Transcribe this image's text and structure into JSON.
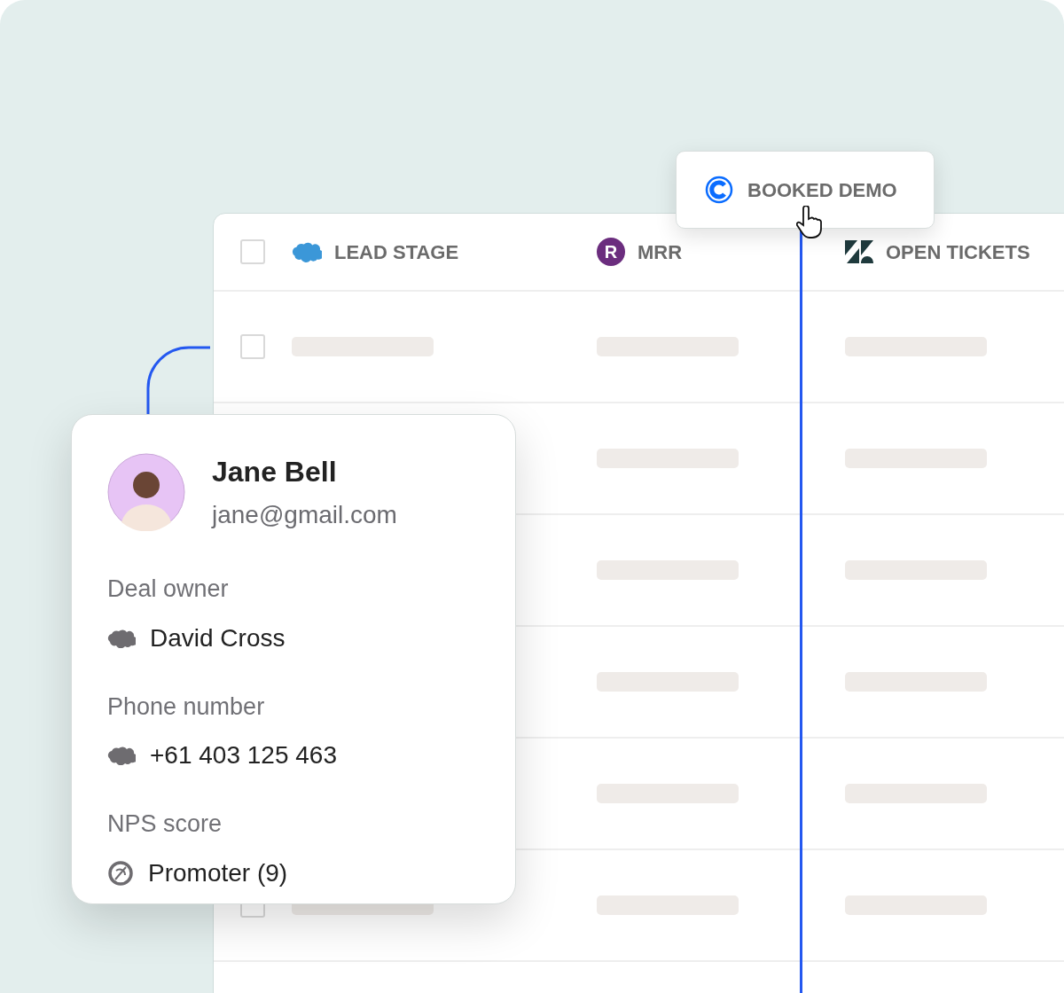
{
  "table": {
    "header_checkbox": {
      "checked": false
    },
    "columns": [
      {
        "label": "LEAD STAGE",
        "kind": "cloud"
      },
      {
        "label": "MRR",
        "kind": "letter",
        "glyph": "R"
      },
      {
        "label": "OPEN TICKETS",
        "kind": "zigzag"
      }
    ],
    "rows": [
      {
        "checked": false
      },
      {},
      {},
      {},
      {},
      {
        "checked": false
      }
    ]
  },
  "popover": {
    "label": "BOOKED DEMO"
  },
  "contact_card": {
    "name": "Jane Bell",
    "email": "jane@gmail.com",
    "fields": [
      {
        "label": "Deal owner",
        "value": "David Cross",
        "kind": "cloud"
      },
      {
        "label": "Phone number",
        "value": "+61 403 125 463",
        "kind": "cloud"
      },
      {
        "label": "NPS score",
        "value": "Promoter (9)",
        "kind": "circle"
      }
    ]
  }
}
